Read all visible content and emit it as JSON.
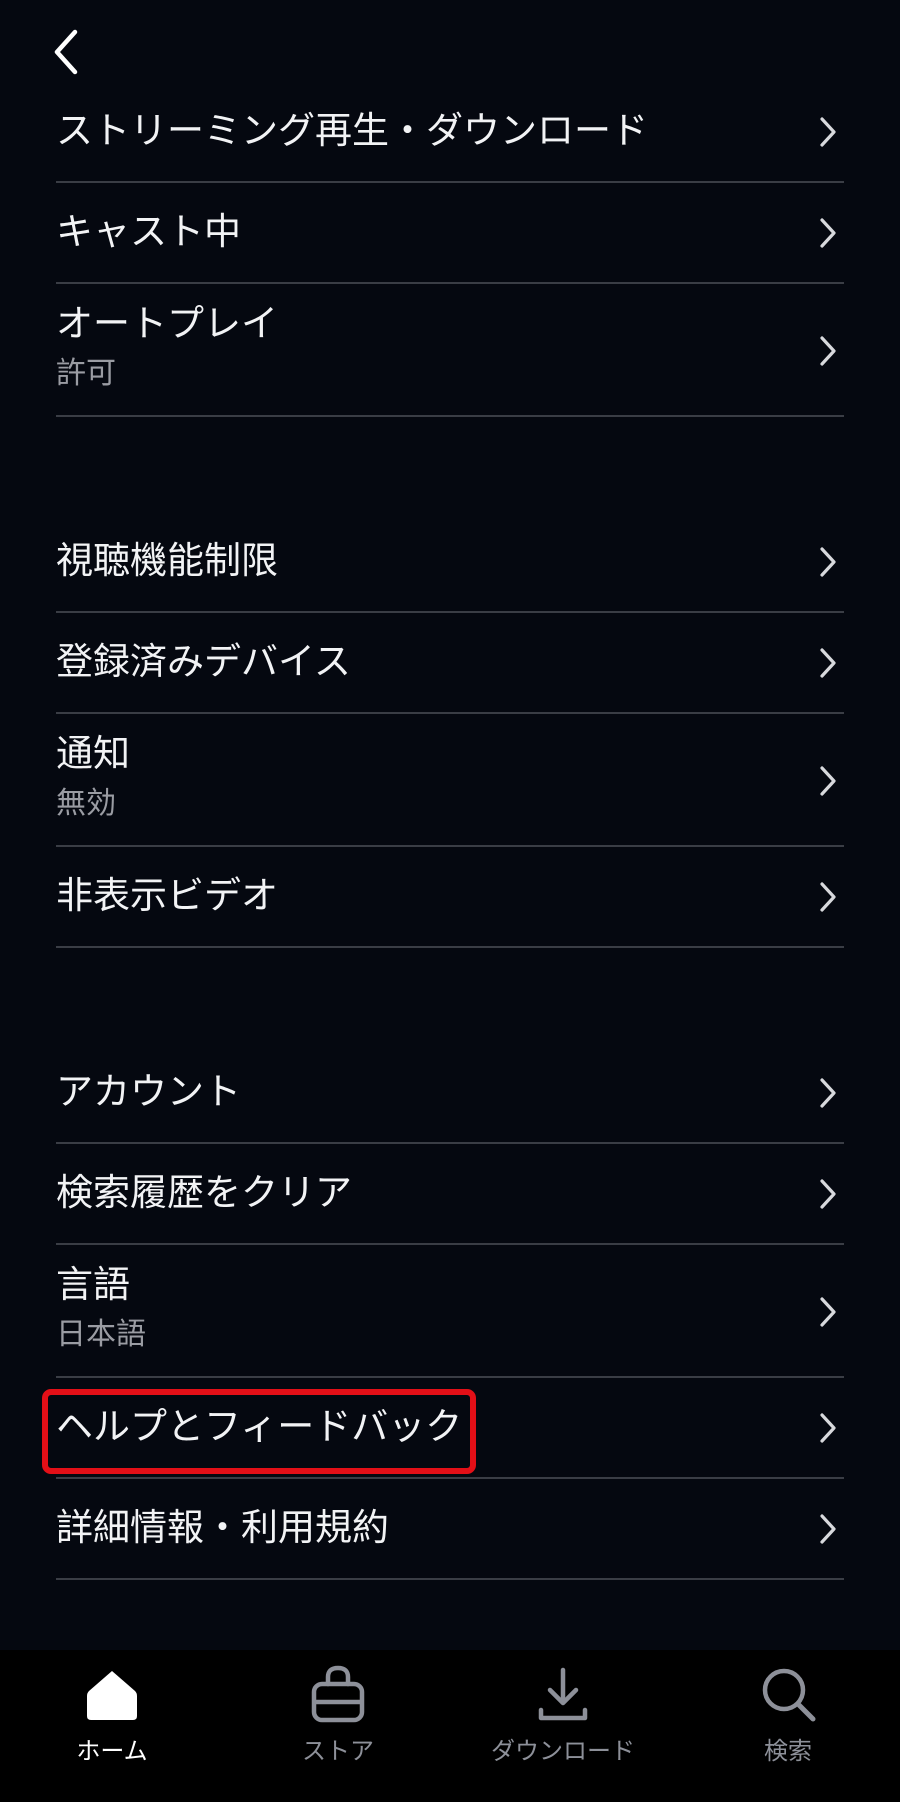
{
  "settings": {
    "group1": [
      {
        "label": "ストリーミング再生・ダウンロード"
      },
      {
        "label": "キャスト中"
      },
      {
        "label": "オートプレイ",
        "value": "許可"
      }
    ],
    "group2": [
      {
        "label": "視聴機能制限"
      },
      {
        "label": "登録済みデバイス"
      },
      {
        "label": "通知",
        "value": "無効"
      },
      {
        "label": "非表示ビデオ"
      }
    ],
    "group3": [
      {
        "label": "アカウント"
      },
      {
        "label": "検索履歴をクリア"
      },
      {
        "label": "言語",
        "value": "日本語"
      },
      {
        "label": "ヘルプとフィードバック",
        "highlighted": true
      },
      {
        "label": "詳細情報・利用規約"
      }
    ]
  },
  "bottom_nav": {
    "active": "home",
    "items": [
      {
        "id": "home",
        "label": "ホーム",
        "icon": "home-icon"
      },
      {
        "id": "store",
        "label": "ストア",
        "icon": "shopping-bag-icon"
      },
      {
        "id": "downloads",
        "label": "ダウンロード",
        "icon": "download-icon"
      },
      {
        "id": "search",
        "label": "検索",
        "icon": "search-icon"
      }
    ]
  },
  "colors": {
    "background": "#050810",
    "divider": "#3a3d45",
    "highlight": "#e30f17",
    "nav_active": "#ffffff",
    "nav_inactive": "#8d9099"
  }
}
